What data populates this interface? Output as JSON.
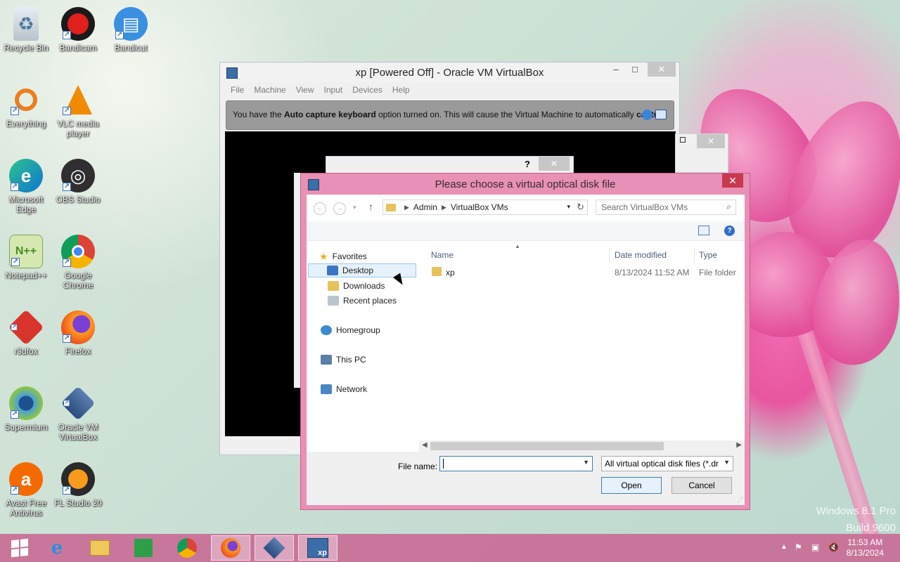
{
  "desktop": {
    "icons": [
      {
        "label": "Recycle Bin",
        "icon": "recycle-bin-icon"
      },
      {
        "label": "Bandicam",
        "icon": "bandicam-icon"
      },
      {
        "label": "Bandicut",
        "icon": "bandicut-icon"
      },
      {
        "label": "Everything",
        "icon": "everything-icon"
      },
      {
        "label": "VLC media player",
        "icon": "vlc-icon"
      },
      {
        "label": "Microsoft Edge",
        "icon": "edge-icon"
      },
      {
        "label": "OBS Studio",
        "icon": "obs-icon"
      },
      {
        "label": "Notepad++",
        "icon": "notepadpp-icon"
      },
      {
        "label": "Google Chrome",
        "icon": "chrome-icon"
      },
      {
        "label": "r3dfox",
        "icon": "r3dfox-icon"
      },
      {
        "label": "Firefox",
        "icon": "firefox-icon"
      },
      {
        "label": "Supermium",
        "icon": "supermium-icon"
      },
      {
        "label": "Oracle VM VirtualBox",
        "icon": "virtualbox-icon"
      },
      {
        "label": "Avast Free Antivirus",
        "icon": "avast-icon"
      },
      {
        "label": "FL Studio 20",
        "icon": "flstudio-icon"
      }
    ]
  },
  "vbox": {
    "title": "xp [Powered Off] - Oracle VM VirtualBox",
    "menu": [
      "File",
      "Machine",
      "View",
      "Input",
      "Devices",
      "Help"
    ],
    "notice_prefix": "You have the ",
    "notice_bold1": "Auto capture keyboard",
    "notice_mid": " option turned on. This will cause the Virtual Machine to automatically ",
    "notice_bold2": "capture",
    "minimize": "–",
    "maximize": "□",
    "close": "✕"
  },
  "bgdialog": {
    "help": "?",
    "close": "✕"
  },
  "filedialog": {
    "title": "Please choose a virtual optical disk file",
    "close": "✕",
    "breadcrumb": [
      "Admin",
      "VirtualBox VMs"
    ],
    "search_placeholder": "Search VirtualBox VMs",
    "nav": {
      "favorites": "Favorites",
      "desktop": "Desktop",
      "downloads": "Downloads",
      "recent": "Recent places",
      "homegroup": "Homegroup",
      "thispc": "This PC",
      "network": "Network"
    },
    "columns": {
      "name": "Name",
      "date": "Date modified",
      "type": "Type"
    },
    "files": [
      {
        "name": "xp",
        "date": "8/13/2024 11:52 AM",
        "type": "File folder"
      }
    ],
    "filename_label": "File name:",
    "filename_value": "",
    "filetype": "All virtual optical disk files (*.dr",
    "open": "Open",
    "cancel": "Cancel",
    "help": "?"
  },
  "watermark": {
    "line1": "Windows 8.1 Pro",
    "line2": "Build 9600"
  },
  "taskbar": {
    "apps": [
      "start-icon",
      "ie-icon",
      "file-explorer-icon",
      "store-icon",
      "chrome-icon",
      "firefox-icon",
      "virtualbox-icon",
      "vbox-xp-icon"
    ],
    "vm_label": "xp",
    "time": "11:53 AM",
    "date": "8/13/2024"
  }
}
